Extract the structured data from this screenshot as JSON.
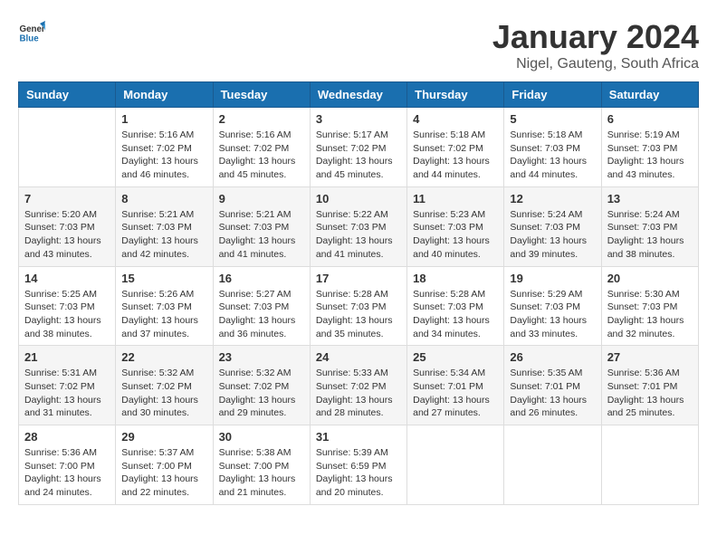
{
  "header": {
    "logo_general": "General",
    "logo_blue": "Blue",
    "month_title": "January 2024",
    "location": "Nigel, Gauteng, South Africa"
  },
  "days_of_week": [
    "Sunday",
    "Monday",
    "Tuesday",
    "Wednesday",
    "Thursday",
    "Friday",
    "Saturday"
  ],
  "weeks": [
    [
      {
        "day": "",
        "info": ""
      },
      {
        "day": "1",
        "info": "Sunrise: 5:16 AM\nSunset: 7:02 PM\nDaylight: 13 hours\nand 46 minutes."
      },
      {
        "day": "2",
        "info": "Sunrise: 5:16 AM\nSunset: 7:02 PM\nDaylight: 13 hours\nand 45 minutes."
      },
      {
        "day": "3",
        "info": "Sunrise: 5:17 AM\nSunset: 7:02 PM\nDaylight: 13 hours\nand 45 minutes."
      },
      {
        "day": "4",
        "info": "Sunrise: 5:18 AM\nSunset: 7:02 PM\nDaylight: 13 hours\nand 44 minutes."
      },
      {
        "day": "5",
        "info": "Sunrise: 5:18 AM\nSunset: 7:03 PM\nDaylight: 13 hours\nand 44 minutes."
      },
      {
        "day": "6",
        "info": "Sunrise: 5:19 AM\nSunset: 7:03 PM\nDaylight: 13 hours\nand 43 minutes."
      }
    ],
    [
      {
        "day": "7",
        "info": "Sunrise: 5:20 AM\nSunset: 7:03 PM\nDaylight: 13 hours\nand 43 minutes."
      },
      {
        "day": "8",
        "info": "Sunrise: 5:21 AM\nSunset: 7:03 PM\nDaylight: 13 hours\nand 42 minutes."
      },
      {
        "day": "9",
        "info": "Sunrise: 5:21 AM\nSunset: 7:03 PM\nDaylight: 13 hours\nand 41 minutes."
      },
      {
        "day": "10",
        "info": "Sunrise: 5:22 AM\nSunset: 7:03 PM\nDaylight: 13 hours\nand 41 minutes."
      },
      {
        "day": "11",
        "info": "Sunrise: 5:23 AM\nSunset: 7:03 PM\nDaylight: 13 hours\nand 40 minutes."
      },
      {
        "day": "12",
        "info": "Sunrise: 5:24 AM\nSunset: 7:03 PM\nDaylight: 13 hours\nand 39 minutes."
      },
      {
        "day": "13",
        "info": "Sunrise: 5:24 AM\nSunset: 7:03 PM\nDaylight: 13 hours\nand 38 minutes."
      }
    ],
    [
      {
        "day": "14",
        "info": "Sunrise: 5:25 AM\nSunset: 7:03 PM\nDaylight: 13 hours\nand 38 minutes."
      },
      {
        "day": "15",
        "info": "Sunrise: 5:26 AM\nSunset: 7:03 PM\nDaylight: 13 hours\nand 37 minutes."
      },
      {
        "day": "16",
        "info": "Sunrise: 5:27 AM\nSunset: 7:03 PM\nDaylight: 13 hours\nand 36 minutes."
      },
      {
        "day": "17",
        "info": "Sunrise: 5:28 AM\nSunset: 7:03 PM\nDaylight: 13 hours\nand 35 minutes."
      },
      {
        "day": "18",
        "info": "Sunrise: 5:28 AM\nSunset: 7:03 PM\nDaylight: 13 hours\nand 34 minutes."
      },
      {
        "day": "19",
        "info": "Sunrise: 5:29 AM\nSunset: 7:03 PM\nDaylight: 13 hours\nand 33 minutes."
      },
      {
        "day": "20",
        "info": "Sunrise: 5:30 AM\nSunset: 7:03 PM\nDaylight: 13 hours\nand 32 minutes."
      }
    ],
    [
      {
        "day": "21",
        "info": "Sunrise: 5:31 AM\nSunset: 7:02 PM\nDaylight: 13 hours\nand 31 minutes."
      },
      {
        "day": "22",
        "info": "Sunrise: 5:32 AM\nSunset: 7:02 PM\nDaylight: 13 hours\nand 30 minutes."
      },
      {
        "day": "23",
        "info": "Sunrise: 5:32 AM\nSunset: 7:02 PM\nDaylight: 13 hours\nand 29 minutes."
      },
      {
        "day": "24",
        "info": "Sunrise: 5:33 AM\nSunset: 7:02 PM\nDaylight: 13 hours\nand 28 minutes."
      },
      {
        "day": "25",
        "info": "Sunrise: 5:34 AM\nSunset: 7:01 PM\nDaylight: 13 hours\nand 27 minutes."
      },
      {
        "day": "26",
        "info": "Sunrise: 5:35 AM\nSunset: 7:01 PM\nDaylight: 13 hours\nand 26 minutes."
      },
      {
        "day": "27",
        "info": "Sunrise: 5:36 AM\nSunset: 7:01 PM\nDaylight: 13 hours\nand 25 minutes."
      }
    ],
    [
      {
        "day": "28",
        "info": "Sunrise: 5:36 AM\nSunset: 7:00 PM\nDaylight: 13 hours\nand 24 minutes."
      },
      {
        "day": "29",
        "info": "Sunrise: 5:37 AM\nSunset: 7:00 PM\nDaylight: 13 hours\nand 22 minutes."
      },
      {
        "day": "30",
        "info": "Sunrise: 5:38 AM\nSunset: 7:00 PM\nDaylight: 13 hours\nand 21 minutes."
      },
      {
        "day": "31",
        "info": "Sunrise: 5:39 AM\nSunset: 6:59 PM\nDaylight: 13 hours\nand 20 minutes."
      },
      {
        "day": "",
        "info": ""
      },
      {
        "day": "",
        "info": ""
      },
      {
        "day": "",
        "info": ""
      }
    ]
  ]
}
